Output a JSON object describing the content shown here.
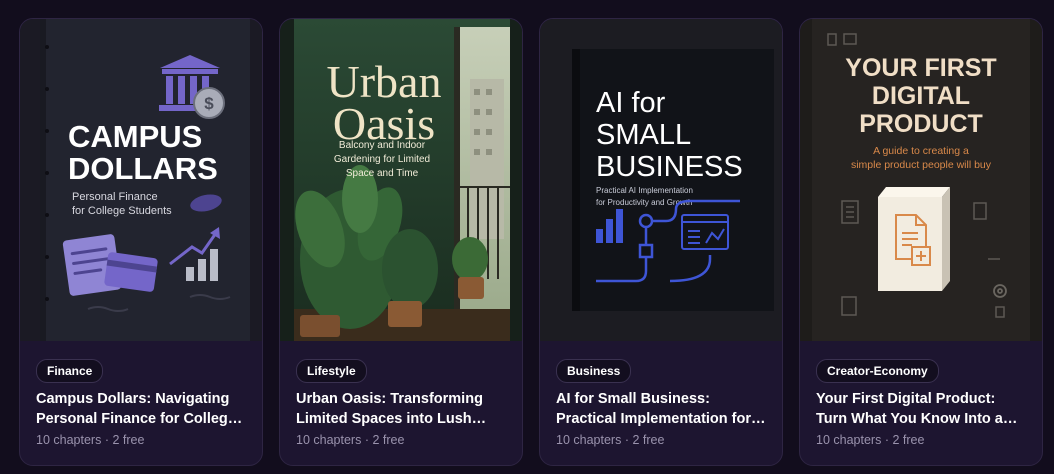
{
  "books": [
    {
      "category": "Finance",
      "title": "Campus Dollars: Navigating Personal Finance for College Students",
      "chapters": "10 chapters",
      "free": "2 free",
      "cover": {
        "title_line1": "CAMPUS",
        "title_line2": "DOLLARS",
        "subtitle_line1": "Personal Finance",
        "subtitle_line2": "for College Students",
        "icons": [
          "bank-icon",
          "coin-icon",
          "document-icon",
          "credit-card-icon",
          "growth-chart-icon"
        ]
      }
    },
    {
      "category": "Lifestyle",
      "title": "Urban Oasis: Transforming Limited Spaces into Lush Gardens",
      "chapters": "10 chapters",
      "free": "2 free",
      "cover": {
        "title_line1": "Urban",
        "title_line2": "Oasis",
        "subtitle_line1": "Balcony and Indoor",
        "subtitle_line2": "Gardening for Limited",
        "subtitle_line3": "Space and Time",
        "icons": [
          "plant-icon",
          "window-icon"
        ]
      }
    },
    {
      "category": "Business",
      "title": "AI for Small Business: Practical Implementation for Productivity and Growth",
      "chapters": "10 chapters",
      "free": "2 free",
      "cover": {
        "title_line1": "AI for",
        "title_line2": "SMALL",
        "title_line3": "BUSINESS",
        "subtitle_line1": "Practical AI Implementation",
        "subtitle_line2": "for Productivity and Growth",
        "icons": [
          "bar-chart-icon",
          "flowchart-icon",
          "dashboard-icon"
        ]
      }
    },
    {
      "category": "Creator-Economy",
      "title": "Your First Digital Product: Turn What You Know Into a Sellable Product",
      "chapters": "10 chapters",
      "free": "2 free",
      "cover": {
        "title_line1": "YOUR FIRST",
        "title_line2": "DIGITAL",
        "title_line3": "PRODUCT",
        "subtitle_line1": "A guide to creating a",
        "subtitle_line2": "simple product people will buy",
        "icons": [
          "product-box-icon",
          "document-add-icon",
          "gear-icon"
        ]
      }
    }
  ],
  "separator": "·",
  "colors": {
    "page_bg": "#120d1d",
    "card_bg": "#1d1530",
    "muted_text": "#9a93ad",
    "finance_accent": "#7466c9",
    "oasis_text": "#efe4c6",
    "ai_accent": "#3e55d6",
    "product_accent": "#d9894a"
  }
}
